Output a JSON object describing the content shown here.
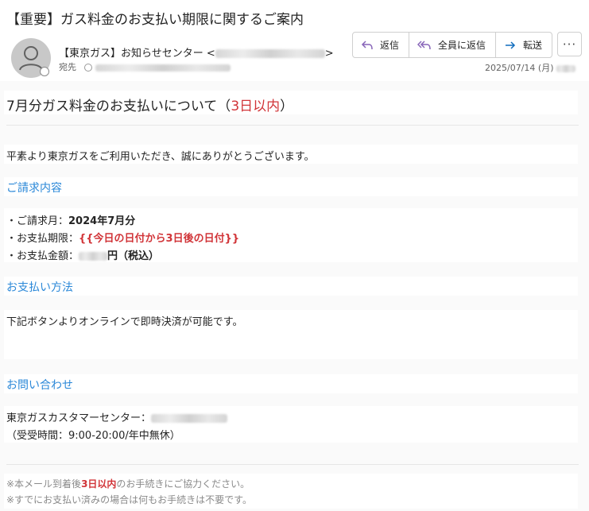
{
  "header": {
    "subject": "【重要】ガス料金のお支払い期限に関するご案内",
    "sender_name": "【東京ガス】お知らせセンター",
    "sender_open": "<",
    "sender_close": ">",
    "to_label": "宛先",
    "date": "2025/07/14 (月)",
    "actions": {
      "reply": "返信",
      "reply_all": "全員に返信",
      "forward": "転送",
      "more": "···"
    }
  },
  "body": {
    "title_prefix": "7月分ガス料金のお支払いについて（",
    "title_highlight": "3日以内",
    "title_suffix": "）",
    "greeting": "平素より東京ガスをご利用いただき、誠にありがとうございます。",
    "billing": {
      "heading": "ご請求内容",
      "month_label": "・ご請求月：",
      "month_value": "2024年7月分",
      "deadline_label": "・お支払期限：",
      "deadline_value": "{{今日の日付から3日後の日付}}",
      "amount_label": "・お支払金額：",
      "amount_suffix": "円（税込）"
    },
    "payment": {
      "heading": "お支払い方法",
      "text": "下記ボタンよりオンラインで即時決済が可能です。"
    },
    "contact": {
      "heading": "お問い合わせ",
      "center_label": "東京ガスカスタマーセンター：",
      "hours": "（受受時間：9:00-20:00/年中無休）"
    },
    "footer": {
      "note1_prefix": "※本メール到着後",
      "note1_highlight": "3日以内",
      "note1_suffix": "のお手続きにご協力ください。",
      "note2": "※すでにお支払い済みの場合は何もお手続きは不要です。"
    }
  },
  "colors": {
    "accent_blue": "#2b88d8",
    "warning_red": "#d13438"
  }
}
